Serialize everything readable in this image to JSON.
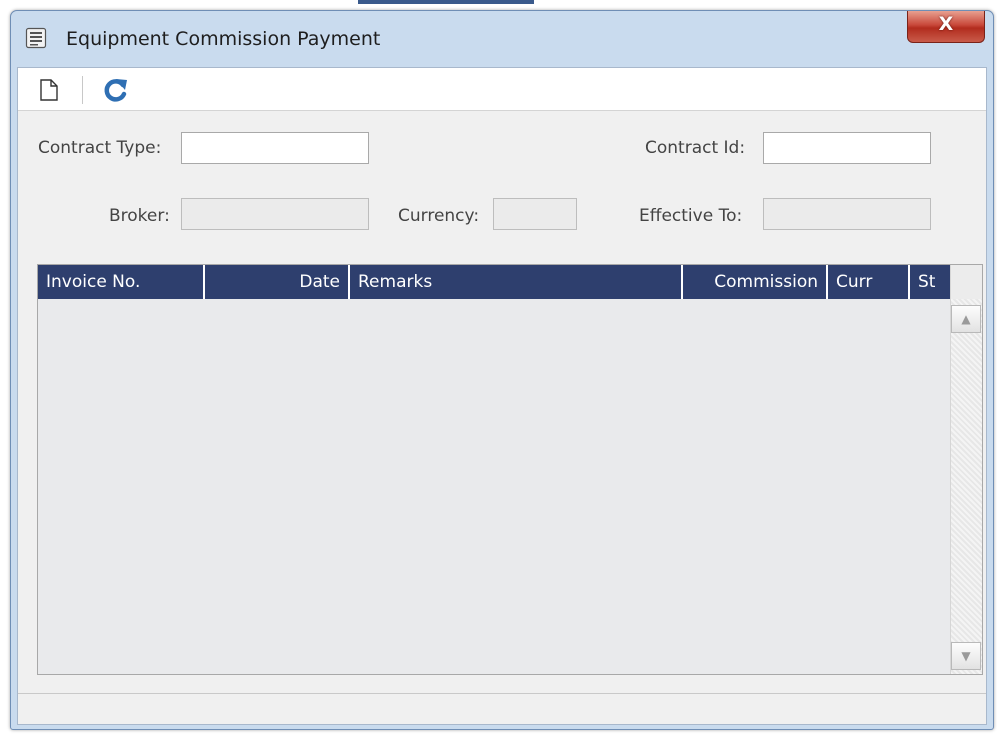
{
  "window": {
    "title": "Equipment Commission Payment",
    "close_label": "X",
    "icon": "form-document-icon"
  },
  "toolbar": {
    "new_icon": "new-document-icon",
    "refresh_icon": "refresh-icon"
  },
  "form": {
    "contract_type_label": "Contract Type:",
    "contract_type_value": "",
    "contract_id_label": "Contract Id:",
    "contract_id_value": "",
    "broker_label": "Broker:",
    "broker_value": "",
    "currency_label": "Currency:",
    "currency_value": "",
    "effective_to_label": "Effective To:",
    "effective_to_value": ""
  },
  "grid": {
    "columns": [
      "Invoice No.",
      "Date",
      "Remarks",
      "Commission",
      "Curr",
      "St"
    ],
    "rows": []
  },
  "colors": {
    "header_bg": "#2e3f6e",
    "window_frame": "#c9dbee",
    "close_button": "#c8483a"
  }
}
